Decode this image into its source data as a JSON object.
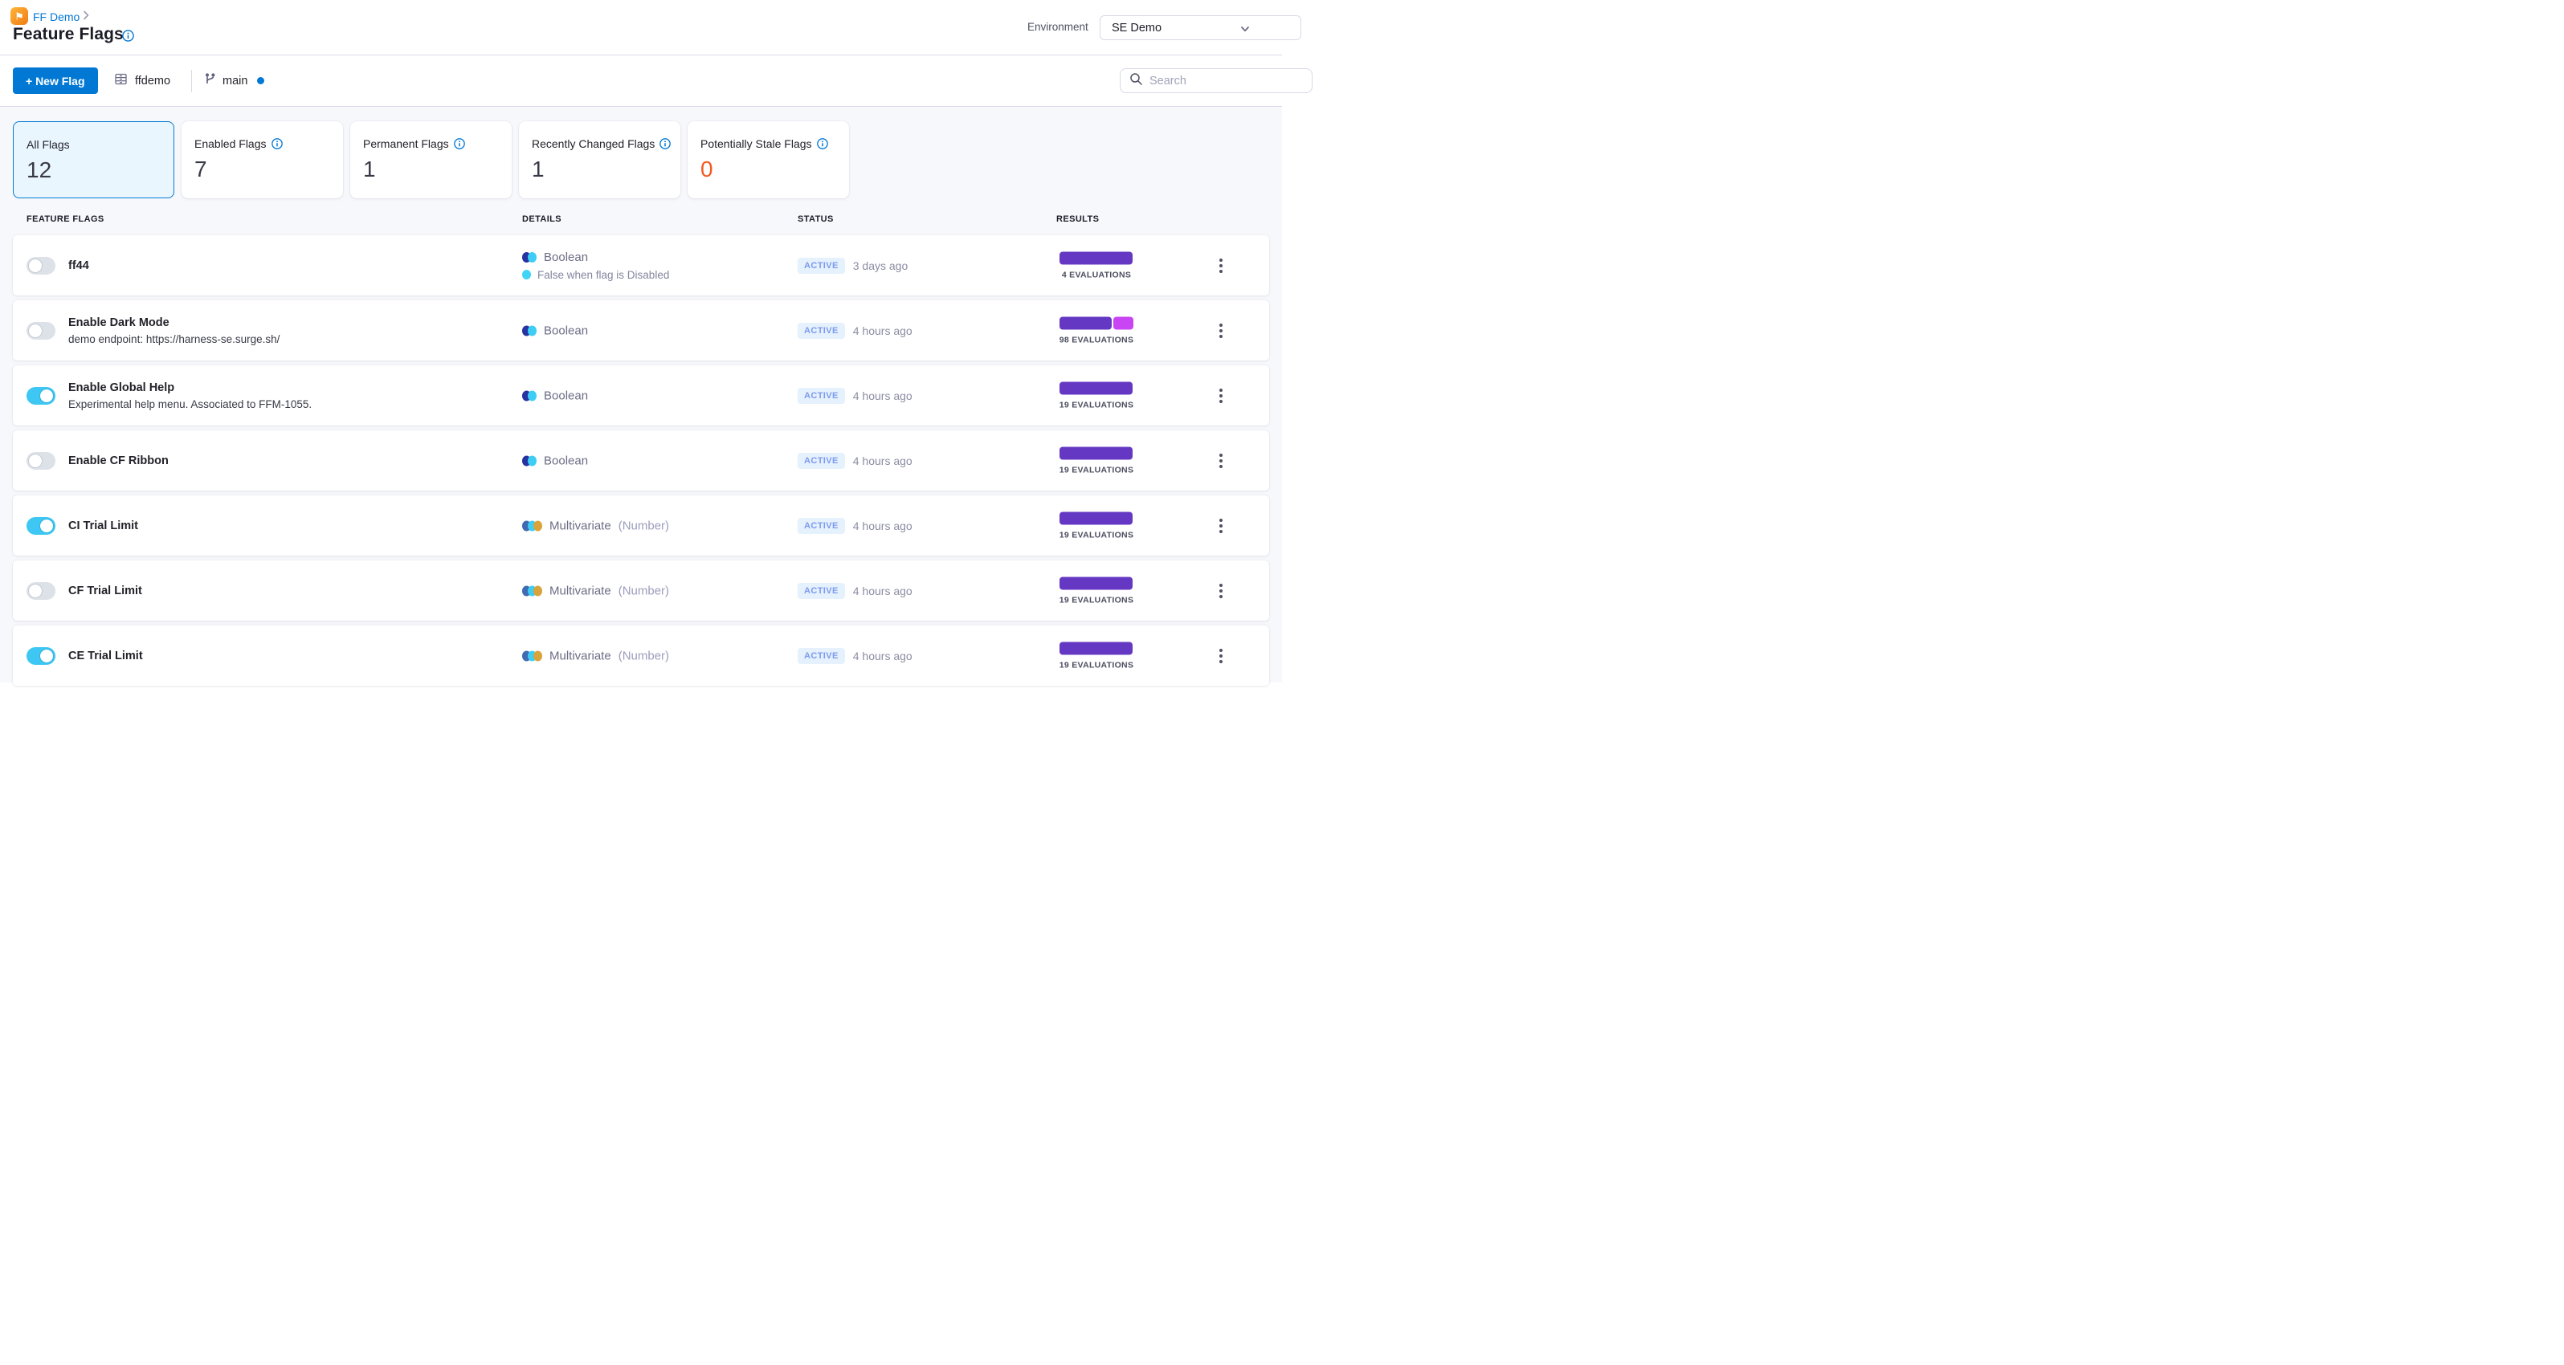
{
  "header": {
    "breadcrumb": {
      "project": "FF Demo"
    },
    "title": "Feature Flags",
    "environment": {
      "label": "Environment",
      "value": "SE Demo"
    }
  },
  "toolbar": {
    "new_flag_label": "+ New Flag",
    "repo": "ffdemo",
    "branch": "main",
    "search_placeholder": "Search"
  },
  "stats": [
    {
      "label": "All Flags",
      "value": "12",
      "selected": true,
      "has_info": false
    },
    {
      "label": "Enabled Flags",
      "value": "7",
      "selected": false,
      "has_info": true
    },
    {
      "label": "Permanent Flags",
      "value": "1",
      "selected": false,
      "has_info": true
    },
    {
      "label": "Recently Changed Flags",
      "value": "1",
      "selected": false,
      "has_info": true
    },
    {
      "label": "Potentially Stale Flags",
      "value": "0",
      "selected": false,
      "has_info": true,
      "value_color": "#f4591e"
    }
  ],
  "table": {
    "columns": {
      "flags": "FEATURE FLAGS",
      "details": "DETAILS",
      "status": "STATUS",
      "results": "RESULTS"
    },
    "rows": [
      {
        "name": "ff44",
        "description": "",
        "enabled": false,
        "type": "Boolean",
        "type_note": "",
        "subtext": "False when flag is Disabled",
        "status": "ACTIVE",
        "updated": "3 days ago",
        "evaluations": "4 EVALUATIONS",
        "segments": [
          {
            "color": "#6438c3",
            "share": 100
          }
        ]
      },
      {
        "name": "Enable Dark Mode",
        "description": "demo endpoint: https://harness-se.surge.sh/",
        "enabled": false,
        "type": "Boolean",
        "type_note": "",
        "subtext": "",
        "status": "ACTIVE",
        "updated": "4 hours ago",
        "evaluations": "98 EVALUATIONS",
        "segments": [
          {
            "color": "#6438c3",
            "share": 72
          },
          {
            "color": "#c944f2",
            "share": 28
          }
        ]
      },
      {
        "name": "Enable Global Help",
        "description": "Experimental help menu. Associated to FFM-1055.",
        "enabled": true,
        "type": "Boolean",
        "type_note": "",
        "subtext": "",
        "status": "ACTIVE",
        "updated": "4 hours ago",
        "evaluations": "19 EVALUATIONS",
        "segments": [
          {
            "color": "#6438c3",
            "share": 100
          }
        ]
      },
      {
        "name": "Enable CF Ribbon",
        "description": "",
        "enabled": false,
        "type": "Boolean",
        "type_note": "",
        "subtext": "",
        "status": "ACTIVE",
        "updated": "4 hours ago",
        "evaluations": "19 EVALUATIONS",
        "segments": [
          {
            "color": "#6438c3",
            "share": 100
          }
        ]
      },
      {
        "name": "CI Trial Limit",
        "description": "",
        "enabled": true,
        "type": "Multivariate",
        "type_note": "(Number)",
        "subtext": "",
        "status": "ACTIVE",
        "updated": "4 hours ago",
        "evaluations": "19 EVALUATIONS",
        "segments": [
          {
            "color": "#6438c3",
            "share": 100
          }
        ]
      },
      {
        "name": "CF Trial Limit",
        "description": "",
        "enabled": false,
        "type": "Multivariate",
        "type_note": "(Number)",
        "subtext": "",
        "status": "ACTIVE",
        "updated": "4 hours ago",
        "evaluations": "19 EVALUATIONS",
        "segments": [
          {
            "color": "#6438c3",
            "share": 100
          }
        ]
      },
      {
        "name": "CE Trial Limit",
        "description": "",
        "enabled": true,
        "type": "Multivariate",
        "type_note": "(Number)",
        "subtext": "",
        "status": "ACTIVE",
        "updated": "4 hours ago",
        "evaluations": "19 EVALUATIONS",
        "segments": [
          {
            "color": "#6438c3",
            "share": 100
          }
        ]
      }
    ]
  },
  "colors": {
    "primary_blue": "#0278d5",
    "toggle_on": "#3dc7f2",
    "bar_purple": "#6438c3",
    "bar_magenta": "#c944f2",
    "stale_orange": "#f4591e",
    "active_badge_bg": "#e5f1fc",
    "active_badge_text": "#7d9bf0"
  }
}
